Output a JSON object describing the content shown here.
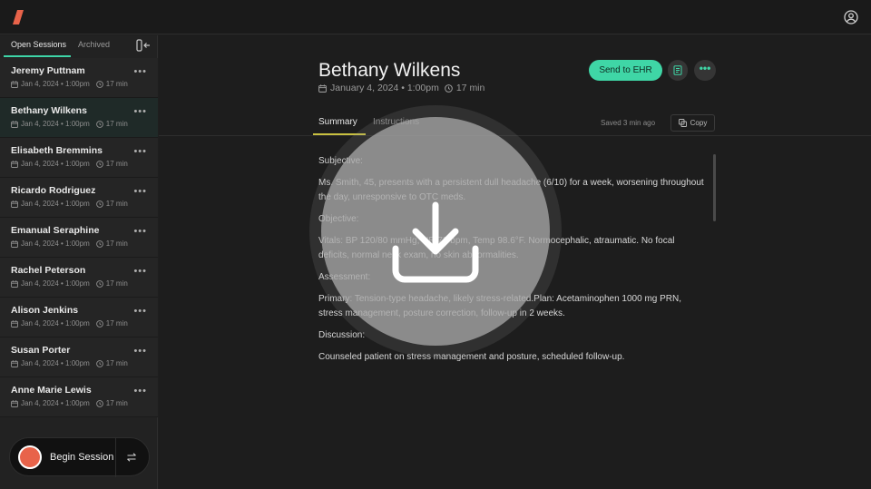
{
  "colors": {
    "accent": "#3fd6a6",
    "record": "#e8634a",
    "logo": "#e8634a",
    "tab_highlight": "#c8c040"
  },
  "topbar": {
    "logo_icon": "logo-slash",
    "account_icon": "user-circle-icon"
  },
  "sidebar": {
    "tabs": [
      "Open Sessions",
      "Archived"
    ],
    "sessions": [
      {
        "name": "Jeremy Puttnam",
        "date": "Jan 4, 2024 • 1:00pm",
        "duration": "17 min"
      },
      {
        "name": "Bethany Wilkens",
        "date": "Jan 4, 2024 • 1:00pm",
        "duration": "17 min"
      },
      {
        "name": "Elisabeth Bremmins",
        "date": "Jan 4, 2024 • 1:00pm",
        "duration": "17 min"
      },
      {
        "name": "Ricardo Rodriguez",
        "date": "Jan 4, 2024 • 1:00pm",
        "duration": "17 min"
      },
      {
        "name": "Emanual Seraphine",
        "date": "Jan 4, 2024 • 1:00pm",
        "duration": "17 min"
      },
      {
        "name": "Rachel Peterson",
        "date": "Jan 4, 2024 • 1:00pm",
        "duration": "17 min"
      },
      {
        "name": "Alison Jenkins",
        "date": "Jan 4, 2024 • 1:00pm",
        "duration": "17 min"
      },
      {
        "name": "Susan Porter",
        "date": "Jan 4, 2024 • 1:00pm",
        "duration": "17 min"
      },
      {
        "name": "Anne Marie Lewis",
        "date": "Jan 4, 2024 • 1:00pm",
        "duration": "17 min"
      }
    ],
    "more": "•••",
    "begin_label": "Begin Session"
  },
  "main": {
    "title": "Bethany Wilkens",
    "date": "January 4, 2024 • 1:00pm",
    "duration": "17 min",
    "send_label": "Send to EHR",
    "more": "•••",
    "tabs": [
      "Summary",
      "Instructions"
    ],
    "saved": "Saved 3 min ago",
    "copy_label": "Copy",
    "sections": [
      {
        "heading": "Subjective:",
        "body": "Ms. Smith, 45, presents with a persistent dull headache (6/10) for a week, worsening throughout the day, unresponsive to OTC meds."
      },
      {
        "heading": "Objective:",
        "body": "Vitals: BP 120/80 mmHg, HR 72 bpm, Temp 98.6°F. Normocephalic, atraumatic. No focal deficits, normal neck exam, no skin abnormalities."
      },
      {
        "heading": "Assessment:",
        "body": "Primary: Tension-type headache, likely stress-related.Plan: Acetaminophen 1000 mg PRN, stress management, posture correction, follow-up in 2 weeks."
      },
      {
        "heading": "Discussion:",
        "body": "Counseled patient on stress management and posture, scheduled follow-up."
      }
    ]
  },
  "overlay": {
    "icon": "download-icon"
  }
}
